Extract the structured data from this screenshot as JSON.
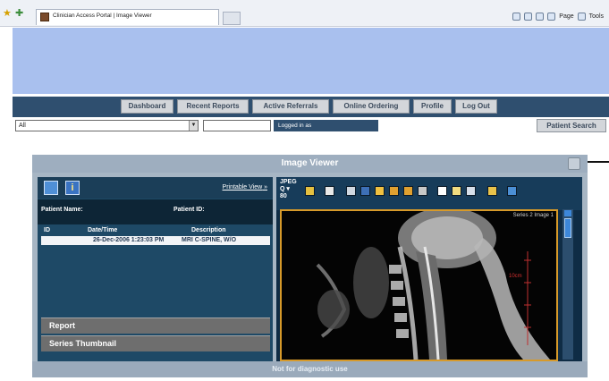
{
  "browser": {
    "tab_title": "Clinician Access Portal | Image Viewer",
    "tools": {
      "page_label": "Page",
      "tools_label": "Tools"
    }
  },
  "nav": {
    "items": [
      {
        "label": "Dashboard"
      },
      {
        "label": "Recent Reports"
      },
      {
        "label": "Active Referrals"
      },
      {
        "label": "Online Ordering"
      },
      {
        "label": "Profile"
      },
      {
        "label": "Log Out"
      }
    ]
  },
  "filter": {
    "select_value": "All",
    "logged_in_text": "Logged in as",
    "patient_search_label": "Patient Search"
  },
  "viewer": {
    "title": "Image Viewer",
    "footer_note": "Not for diagnostic use",
    "left": {
      "printable_view": "Printable View",
      "patient_name_label": "Patient Name:",
      "patient_id_label": "Patient ID:",
      "columns": {
        "id": "ID",
        "datetime": "Date/Time",
        "description": "Description"
      },
      "study": {
        "datetime": "26-Dec-2006 1:23:03 PM",
        "description": "MRI C-SPINE, W/O"
      },
      "report_label": "Report",
      "series_thumbnail_label": "Series Thumbnail"
    },
    "right": {
      "format_label": "JPEG",
      "series_label": "Series 2 Image 1",
      "scale_label": "10cm"
    }
  },
  "colors": {
    "banner": "#a9c0ee",
    "navbar": "#2f4f6f",
    "viewer_frame": "#a7b6c4",
    "image_border": "#d79a2a"
  }
}
